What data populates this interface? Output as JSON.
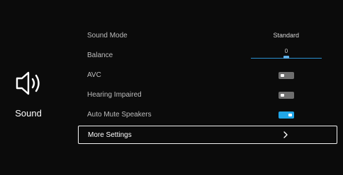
{
  "sidebar": {
    "icon": "speaker-icon",
    "label": "Sound"
  },
  "menu": {
    "sound_mode": {
      "label": "Sound Mode",
      "value": "Standard"
    },
    "balance": {
      "label": "Balance",
      "value": "0",
      "level_fraction": 0.5
    },
    "avc": {
      "label": "AVC",
      "state": "off"
    },
    "hearing_impaired": {
      "label": "Hearing Impaired",
      "state": "off"
    },
    "auto_mute": {
      "label": "Auto Mute Speakers",
      "state": "on"
    },
    "more_settings": {
      "label": "More Settings",
      "icon": "chevron-right-icon"
    }
  },
  "colors": {
    "background": "#0b0b0b",
    "accent": "#21a6e8",
    "toggle_off": "#6e6e6e",
    "focus_border": "#f2f2f2"
  }
}
